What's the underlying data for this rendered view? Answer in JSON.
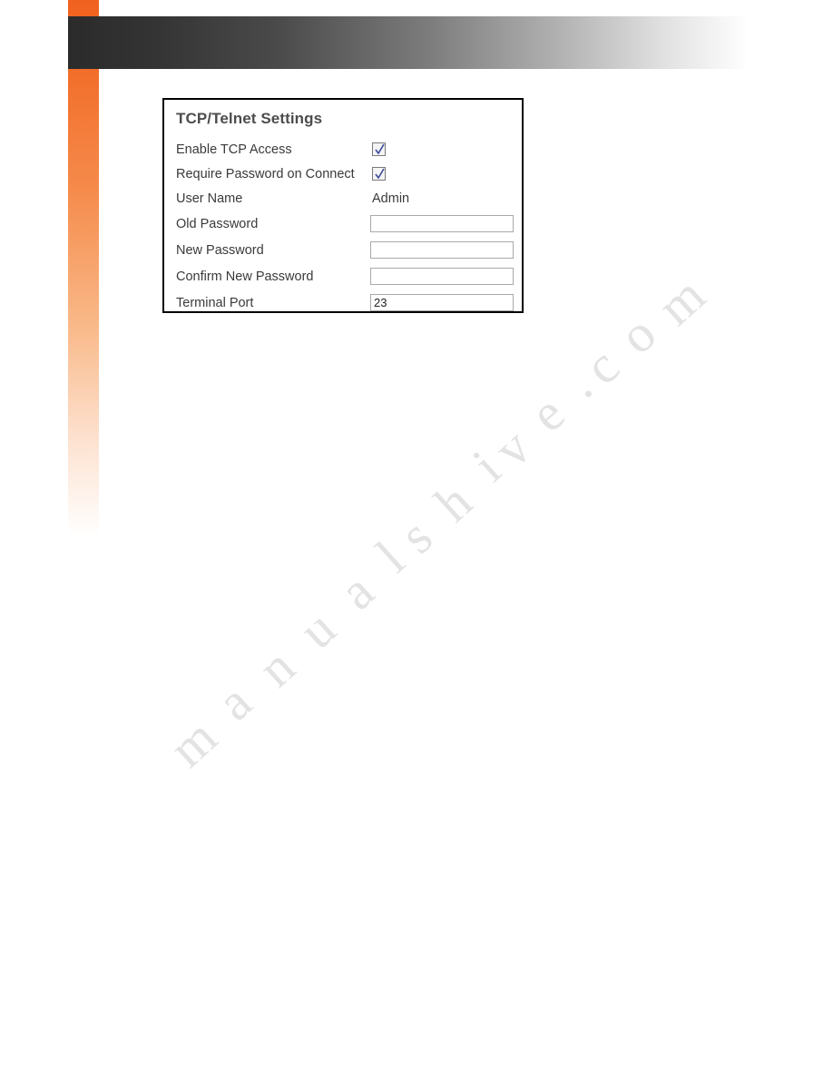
{
  "panel": {
    "title": "TCP/Telnet Settings",
    "rows": [
      {
        "label": "Enable TCP Access",
        "type": "checkbox",
        "checked": true,
        "name": "enable-tcp-access"
      },
      {
        "label": "Require Password on Connect",
        "type": "checkbox",
        "checked": true,
        "name": "require-password-on-connect"
      },
      {
        "label": "User Name",
        "type": "text-static",
        "value": "Admin",
        "name": "user-name"
      },
      {
        "label": "Old Password",
        "type": "input",
        "value": "",
        "name": "old-password"
      },
      {
        "label": "New Password",
        "type": "input",
        "value": "",
        "name": "new-password"
      },
      {
        "label": "Confirm New Password",
        "type": "input",
        "value": "",
        "name": "confirm-new-password"
      },
      {
        "label": "Terminal Port",
        "type": "input",
        "value": "23",
        "name": "terminal-port"
      }
    ]
  },
  "watermark": {
    "text": "manualshive.com"
  },
  "colors": {
    "accent_orange": "#f0621f",
    "header_dark": "#2b2b2b",
    "panel_border": "#000000",
    "label_text": "#3a3a3a",
    "title_text": "#4d4d4d"
  }
}
